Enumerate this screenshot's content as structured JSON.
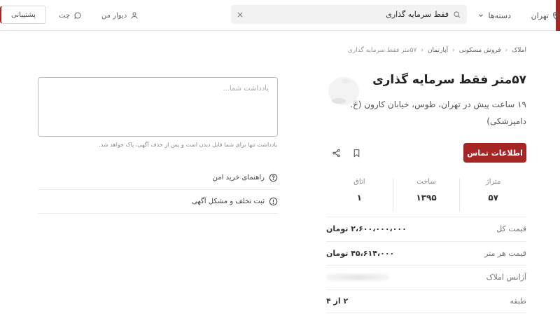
{
  "header": {
    "city": "تهران",
    "categories": "دسته‌ها",
    "search_query": "فقط سرمایه گذاری",
    "clear_symbol": "×",
    "my_divar": "دیوار من",
    "chat": "چت",
    "support": "پشتیبانی",
    "brand_color": "#a62626"
  },
  "breadcrumb": [
    "املاک",
    "فروش مسکونی",
    "آپارتمان",
    "۵۷متر فقط سرمایه گذاری"
  ],
  "listing": {
    "title": "۵۷متر فقط سرمایه گذاری",
    "subtitle": "۱۹ ساعت پیش در تهران، طوس، خیابان کارون (خ. دامپزشکی)",
    "contact_label": "اطلاعات تماس",
    "stats": [
      {
        "label": "متراژ",
        "value": "۵۷"
      },
      {
        "label": "ساخت",
        "value": "۱۳۹۵"
      },
      {
        "label": "اتاق",
        "value": "۱"
      }
    ],
    "details": [
      {
        "label": "قیمت کل",
        "value": "۲،۶۰۰،۰۰۰،۰۰۰ تومان"
      },
      {
        "label": "قیمت هر متر",
        "value": "۴۵،۶۱۴،۰۰۰ تومان"
      },
      {
        "label": "آژانس املاک",
        "value": ""
      },
      {
        "label": "طبقه",
        "value": "۲ از ۴"
      }
    ]
  },
  "note": {
    "placeholder": "یادداشت شما...",
    "hint": "یادداشت تنها برای شما قابل دیدن است و پس از حذف آگهی، پاک خواهد شد."
  },
  "side_links": [
    {
      "label": "راهنمای خرید امن",
      "icon": "question-circle-icon"
    },
    {
      "label": "ثبت تخلف و مشکل آگهی",
      "icon": "alert-circle-icon"
    }
  ]
}
